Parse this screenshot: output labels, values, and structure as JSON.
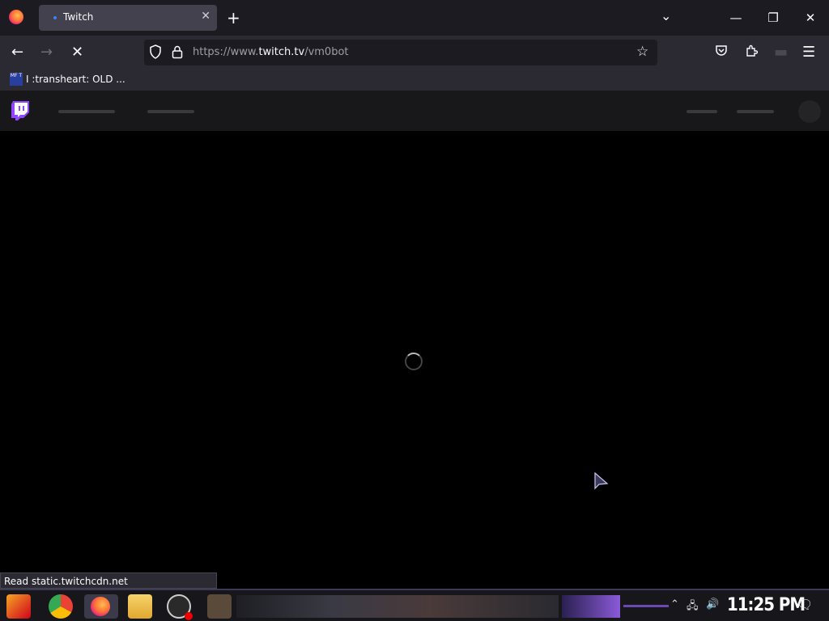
{
  "browser": {
    "tab": {
      "title": "Twitch"
    },
    "url": {
      "scheme_and_sub": "https://www.",
      "host": "twitch.tv",
      "path": "/vm0bot"
    },
    "bookmark": {
      "icon_text": "MF T",
      "label": "I :transheart: OLD ..."
    },
    "status_text": "Read static.twitchcdn.net"
  },
  "taskbar": {
    "clock": "11:25 PM"
  },
  "colors": {
    "twitch_purple": "#9147ff",
    "content_bg": "#000000"
  }
}
